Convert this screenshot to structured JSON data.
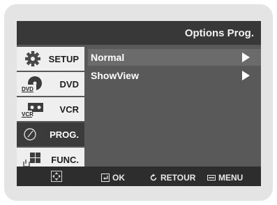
{
  "header": {
    "title": "Options Prog."
  },
  "menu": [
    {
      "label": "SETUP",
      "icon": "gear-icon"
    },
    {
      "label": "DVD",
      "icon": "dvd-disc-icon"
    },
    {
      "label": "VCR",
      "icon": "vcr-cassette-icon"
    },
    {
      "label": "PROG.",
      "icon": "clock-icon",
      "active": true
    },
    {
      "label": "FUNC.",
      "icon": "function-blocks-icon"
    }
  ],
  "options": [
    {
      "label": "Normal",
      "highlighted": true
    },
    {
      "label": "ShowView"
    }
  ],
  "footer": {
    "ok_label": "OK",
    "retour_label": "RETOUR",
    "menu_label": "MENU"
  }
}
